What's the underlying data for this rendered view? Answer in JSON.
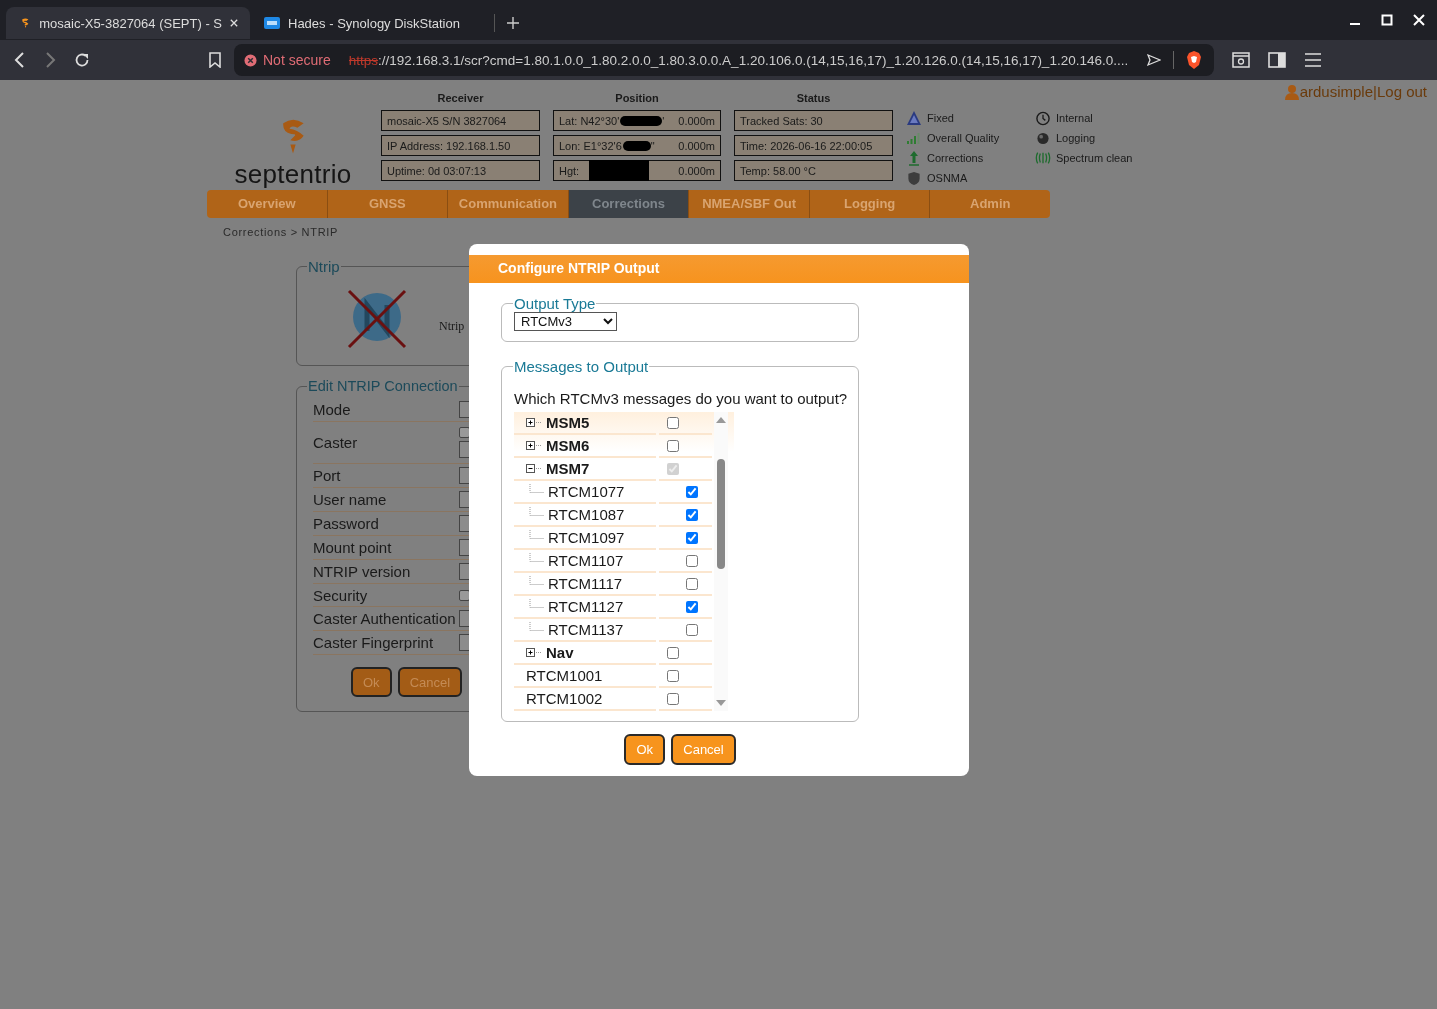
{
  "browser": {
    "tabs": [
      {
        "title": "mosaic-X5-3827064 (SEPT) - S",
        "kind": "septentrio",
        "selected": true
      },
      {
        "title": "Hades - Synology DiskStation",
        "kind": "dsm",
        "selected": false
      }
    ],
    "security": "Not secure",
    "url_scheme": "https",
    "url_rest": "://192.168.3.1/scr?cmd=1.80.1.0.0_1.80.2.0.0_1.80.3.0.0.A_1.20.106.0.(14,15,16,17)_1.20.126.0.(14,15,16,17)_1.20.146.0...."
  },
  "user": {
    "name": "ardusimple",
    "separator": "|",
    "logout": "Log out"
  },
  "logo": "septentrio",
  "receiver": {
    "heading": "Receiver",
    "cells": [
      {
        "text": "mosaic-X5 S/N 3827064"
      },
      {
        "text": "IP Address: 192.168.1.50"
      },
      {
        "text": "Uptime: 0d 03:07:13"
      }
    ]
  },
  "position": {
    "heading": "Position",
    "cells": [
      {
        "text": "Lat:  N42°30'",
        "redacted": true,
        "tail": "'",
        "value": "0.000m"
      },
      {
        "text": "Lon: E1°32'6",
        "redacted": true,
        "tail": "\"",
        "value": "0.000m"
      },
      {
        "text": "Hgt:",
        "redacted": true,
        "value": "0.000m"
      }
    ]
  },
  "status": {
    "heading": "Status",
    "cells": [
      {
        "text": "Tracked Sats: 30"
      },
      {
        "text": "Time: 2026-06-16 22:00:05"
      },
      {
        "text": "Temp: 58.00 °C"
      }
    ]
  },
  "legend_left": [
    {
      "label": "Fixed",
      "kind": "fixed"
    },
    {
      "label": "Overall Quality",
      "kind": "quality"
    },
    {
      "label": "Corrections",
      "kind": "corrections"
    },
    {
      "label": "OSNMA",
      "kind": "osnma"
    }
  ],
  "legend_right": [
    {
      "label": "Internal",
      "kind": "clock"
    },
    {
      "label": "Logging",
      "kind": "logging"
    },
    {
      "label": "Spectrum clean",
      "kind": "spectrum"
    }
  ],
  "nav_tabs": [
    {
      "label": "Overview",
      "selected": false
    },
    {
      "label": "GNSS",
      "selected": false
    },
    {
      "label": "Communication",
      "selected": false
    },
    {
      "label": "Corrections",
      "selected": true
    },
    {
      "label": "NMEA/SBF Out",
      "selected": false
    },
    {
      "label": "Logging",
      "selected": false
    },
    {
      "label": "Admin",
      "selected": false
    }
  ],
  "breadcrumb": "Corrections > NTRIP",
  "ntrip_panel": {
    "legend": "Ntrip",
    "status_text": "Ntrip"
  },
  "edit_panel": {
    "legend": "Edit NTRIP Connection",
    "fields": [
      {
        "label": "Mode",
        "kind": "select"
      },
      {
        "label": "Caster",
        "kind": "caster",
        "checked": false
      },
      {
        "label": "Port",
        "kind": "text"
      },
      {
        "label": "User name",
        "kind": "text"
      },
      {
        "label": "Password",
        "kind": "text"
      },
      {
        "label": "Mount point",
        "kind": "text"
      },
      {
        "label": "NTRIP version",
        "kind": "select"
      },
      {
        "label": "Security",
        "kind": "checkbox",
        "checked": false
      },
      {
        "label": "Caster Authentication",
        "kind": "text"
      },
      {
        "label": "Caster Fingerprint",
        "kind": "text"
      }
    ],
    "buttons": [
      "Ok",
      "Cancel"
    ]
  },
  "dialog": {
    "title": "Configure NTRIP Output",
    "output_type": {
      "legend": "Output Type",
      "value": "RTCMv3"
    },
    "messages": {
      "legend": "Messages to Output",
      "question": "Which RTCMv3 messages do you want to output?",
      "rows": [
        {
          "label": "MSM5",
          "kind": "group",
          "expanded": false,
          "checked": false,
          "disabled": false
        },
        {
          "label": "MSM6",
          "kind": "group",
          "expanded": false,
          "checked": false,
          "disabled": false
        },
        {
          "label": "MSM7",
          "kind": "group",
          "expanded": true,
          "checked": true,
          "disabled": true
        },
        {
          "label": "RTCM1077",
          "kind": "child",
          "checked": true,
          "disabled": false
        },
        {
          "label": "RTCM1087",
          "kind": "child",
          "checked": true,
          "disabled": false
        },
        {
          "label": "RTCM1097",
          "kind": "child",
          "checked": true,
          "disabled": false
        },
        {
          "label": "RTCM1107",
          "kind": "child",
          "checked": false,
          "disabled": false
        },
        {
          "label": "RTCM1117",
          "kind": "child",
          "checked": false,
          "disabled": false
        },
        {
          "label": "RTCM1127",
          "kind": "child",
          "checked": true,
          "disabled": false
        },
        {
          "label": "RTCM1137",
          "kind": "child",
          "checked": false,
          "disabled": false
        },
        {
          "label": "Nav",
          "kind": "group",
          "expanded": false,
          "checked": false,
          "disabled": false
        },
        {
          "label": "RTCM1001",
          "kind": "item",
          "checked": false,
          "disabled": false
        },
        {
          "label": "RTCM1002",
          "kind": "item",
          "checked": false,
          "disabled": false
        }
      ]
    },
    "buttons": [
      "Ok",
      "Cancel"
    ]
  }
}
